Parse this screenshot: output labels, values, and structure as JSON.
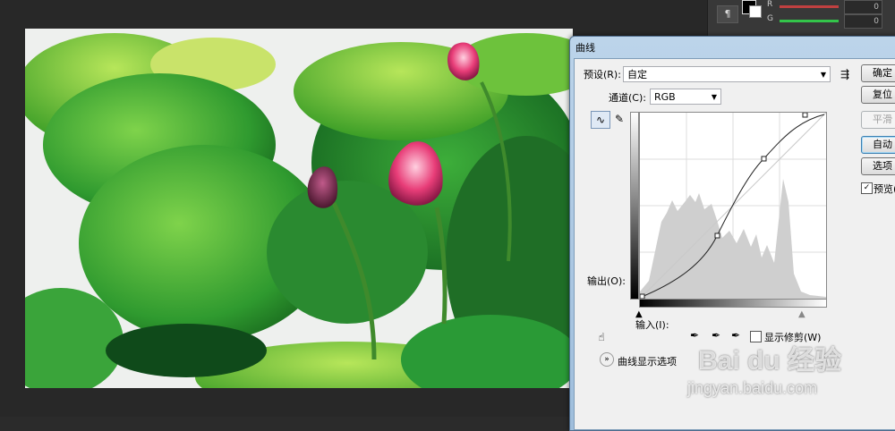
{
  "app": {
    "panel_tool_glyph": "¶",
    "channel_labels": [
      "R",
      "G"
    ],
    "channel_values": [
      "0",
      "0"
    ]
  },
  "dialog": {
    "title": "曲线",
    "preset_label": "预设(R):",
    "preset_value": "自定",
    "channel_label": "通道(C):",
    "channel_value": "RGB",
    "output_label": "输出(O):",
    "input_label": "输入(I):",
    "show_clipping_label": "显示修剪(W)",
    "curve_options_label": "曲线显示选项",
    "buttons": {
      "ok": "确定",
      "reset": "复位",
      "smooth": "平滑",
      "auto": "自动",
      "options": "选项"
    },
    "preview_label": "预览(P)",
    "preview_checked": true
  },
  "watermark": {
    "brand": "Bai du 经验",
    "url": "jingyan.baidu.com"
  },
  "colors": {
    "accent_green": "#33c44a",
    "dialog_title_bar": "#b3cde6"
  }
}
